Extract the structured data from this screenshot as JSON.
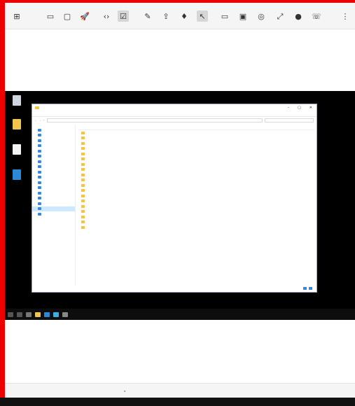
{
  "toolbar": {
    "buttons": [
      {
        "name": "grid-menu-icon",
        "glyph": "⊞"
      },
      {
        "name": "window-icon",
        "glyph": "▭"
      },
      {
        "name": "folder-icon",
        "glyph": "▢"
      },
      {
        "name": "rocket-icon",
        "glyph": "🚀"
      },
      {
        "name": "code-icon",
        "glyph": "‹›"
      },
      {
        "name": "check-box-icon",
        "glyph": "☑"
      },
      {
        "name": "pen-icon",
        "glyph": "✎"
      },
      {
        "name": "share-icon",
        "glyph": "⇪"
      },
      {
        "name": "pin-icon",
        "glyph": "♦"
      },
      {
        "name": "cursor-icon",
        "glyph": "↖"
      },
      {
        "name": "monitor-icon",
        "glyph": "▭"
      },
      {
        "name": "layout-icon",
        "glyph": "▣"
      },
      {
        "name": "camera-icon",
        "glyph": "◎"
      },
      {
        "name": "expand-icon",
        "glyph": "⤢"
      },
      {
        "name": "record-icon",
        "glyph": "●"
      },
      {
        "name": "chat-icon",
        "glyph": "☏"
      },
      {
        "name": "more-vertical-icon",
        "glyph": "⋮"
      }
    ]
  },
  "accent_color": "#e85b1a",
  "explorer": {
    "nav_items": [
      {
        "label": "",
        "icon_color": "#3a86d8",
        "selected": false
      },
      {
        "label": "",
        "icon_color": "#3a86d8",
        "selected": false
      },
      {
        "label": "",
        "icon_color": "#3a86d8",
        "selected": false
      },
      {
        "label": "",
        "icon_color": "#3a86d8",
        "selected": false
      },
      {
        "label": "",
        "icon_color": "#3a86d8",
        "selected": false
      },
      {
        "label": "",
        "icon_color": "#3a86d8",
        "selected": false
      },
      {
        "label": "",
        "icon_color": "#3a86d8",
        "selected": false
      },
      {
        "label": "",
        "icon_color": "#3a86d8",
        "selected": false
      },
      {
        "label": "",
        "icon_color": "#3a86d8",
        "selected": false
      },
      {
        "label": "",
        "icon_color": "#3a86d8",
        "selected": false
      },
      {
        "label": "",
        "icon_color": "#3a86d8",
        "selected": false
      },
      {
        "label": "",
        "icon_color": "#3a86d8",
        "selected": false
      },
      {
        "label": "",
        "icon_color": "#3a86d8",
        "selected": false
      },
      {
        "label": "",
        "icon_color": "#3a86d8",
        "selected": false
      },
      {
        "label": "",
        "icon_color": "#3a86d8",
        "selected": false
      },
      {
        "label": "",
        "icon_color": "#3a86d8",
        "selected": true
      },
      {
        "label": "",
        "icon_color": "#3a86d8",
        "selected": false
      }
    ],
    "folder_rows": [
      {
        "name": ""
      },
      {
        "name": ""
      },
      {
        "name": ""
      },
      {
        "name": ""
      },
      {
        "name": ""
      },
      {
        "name": ""
      },
      {
        "name": ""
      },
      {
        "name": ""
      },
      {
        "name": ""
      },
      {
        "name": ""
      },
      {
        "name": ""
      },
      {
        "name": ""
      },
      {
        "name": ""
      },
      {
        "name": ""
      },
      {
        "name": ""
      },
      {
        "name": ""
      },
      {
        "name": ""
      },
      {
        "name": ""
      },
      {
        "name": ""
      }
    ]
  },
  "desktop_icons": [
    {
      "label": "",
      "color": "#cfd6e0"
    },
    {
      "label": "",
      "color": "#f1c44f"
    },
    {
      "label": "",
      "color": "#f4f4f4"
    },
    {
      "label": "",
      "color": "#2b88d8"
    }
  ],
  "taskbar_items": [
    {
      "color": "#555555"
    },
    {
      "color": "#555555"
    },
    {
      "color": "#777777"
    },
    {
      "color": "#f1c44f"
    },
    {
      "color": "#2b88d8"
    },
    {
      "color": "#3bb0e0"
    },
    {
      "color": "#888888"
    }
  ]
}
